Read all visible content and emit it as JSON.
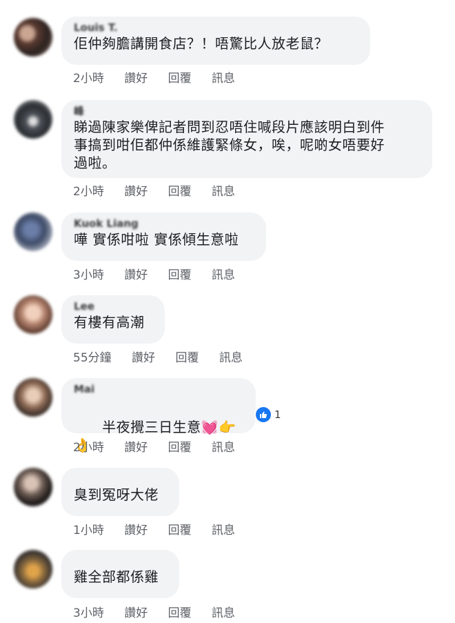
{
  "comments": [
    {
      "name": "Louis T.",
      "text": "佢仲夠膽講開食店？！唔驚比人放老鼠？",
      "time": "2小時",
      "like": "讚好",
      "reply": "回覆",
      "message": "訊息"
    },
    {
      "name": "峰",
      "text": "睇過陳家樂俾記者問到忍唔住喊段片應該明白到件\n事搞到咁佢都仲係維護緊條女，唉，呢啲女唔要好\n過啦。",
      "time": "2小時",
      "like": "讚好",
      "reply": "回覆",
      "message": "訊息"
    },
    {
      "name": "Kuok Liang",
      "text": "嘩 實係咁啦 實係傾生意啦",
      "time": "3小時",
      "like": "讚好",
      "reply": "回覆",
      "message": "訊息"
    },
    {
      "name": "Lee",
      "text": "有樓有高潮",
      "time": "55分鐘",
      "like": "讚好",
      "reply": "回覆",
      "message": "訊息"
    },
    {
      "name": "Mai",
      "text": "半夜攪三日生意",
      "emoji": "💓👉👌",
      "time": "2小時",
      "like": "讚好",
      "reply": "回覆",
      "message": "訊息",
      "reaction_icon": "like-icon",
      "reaction_count": "1"
    },
    {
      "name": "",
      "text": "臭到冤呀大佬",
      "time": "1小時",
      "like": "讚好",
      "reply": "回覆",
      "message": "訊息"
    },
    {
      "name": "",
      "text": "雞全部都係雞",
      "time": "3小時",
      "like": "讚好",
      "reply": "回覆",
      "message": "訊息"
    }
  ]
}
